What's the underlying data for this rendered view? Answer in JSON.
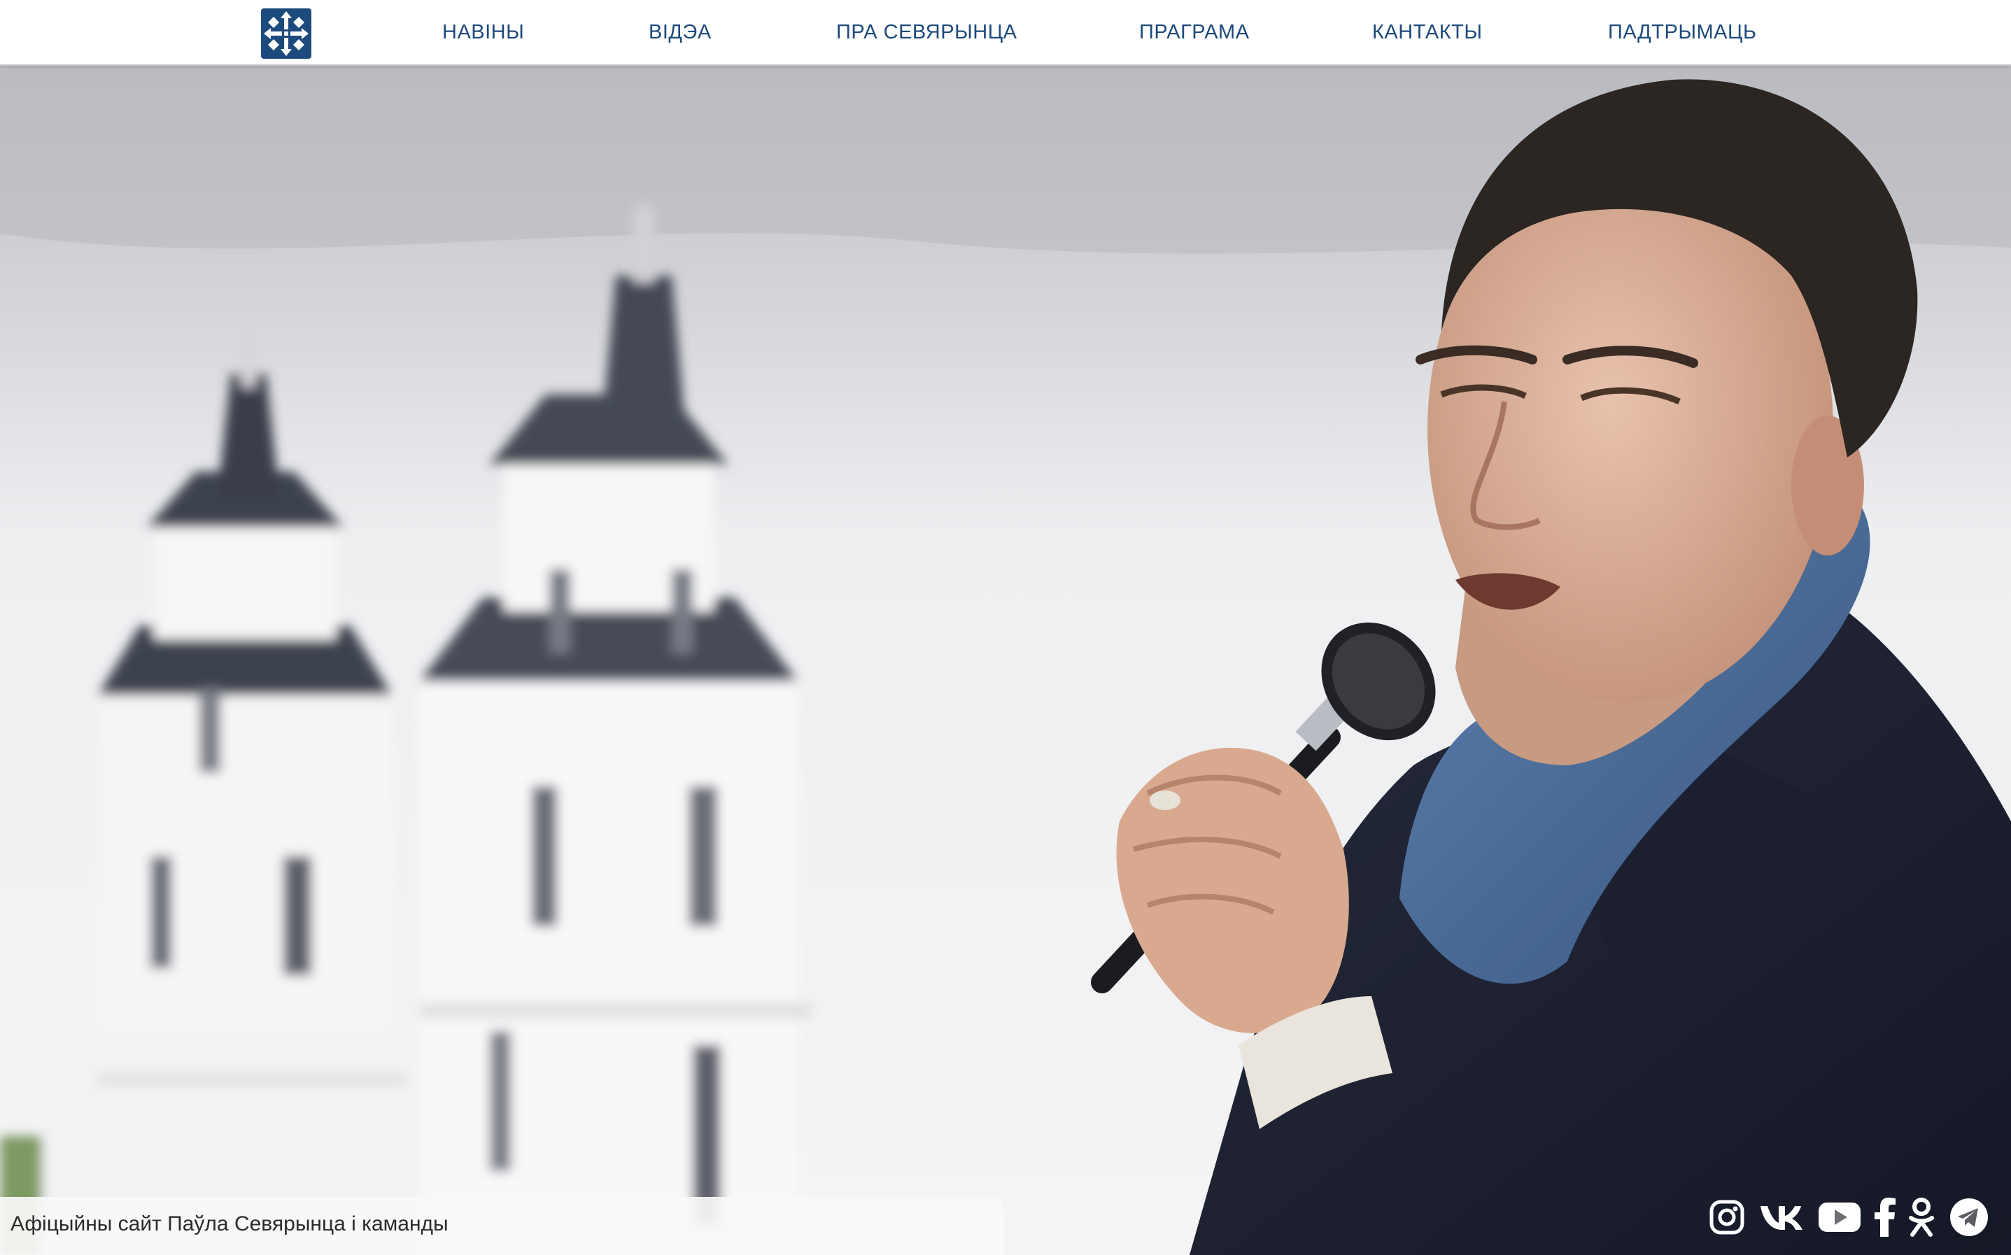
{
  "header": {
    "logo_icon": "cross-ornament-logo-icon",
    "nav": [
      {
        "label": "НАВІНЫ"
      },
      {
        "label": "ВІДЭА"
      },
      {
        "label": "ПРА СЕВЯРЫНЦА"
      },
      {
        "label": "ПРАГРАМА"
      },
      {
        "label": "КАНТАКТЫ"
      },
      {
        "label": "ПАДТРЫМАЦЬ"
      }
    ]
  },
  "hero": {
    "image": "photo of speaker with microphone in front of white church towers"
  },
  "footer": {
    "caption": "Афіцыйны сайт Паўла Севярынца і каманды",
    "social": [
      {
        "icon": "instagram-icon"
      },
      {
        "icon": "vk-icon"
      },
      {
        "icon": "youtube-icon"
      },
      {
        "icon": "facebook-icon"
      },
      {
        "icon": "odnoklassniki-icon"
      },
      {
        "icon": "telegram-icon"
      }
    ]
  },
  "colors": {
    "nav_text": "#1d4a7c",
    "logo": "#1d4a7c",
    "topbar_bg": "#ffffff"
  }
}
